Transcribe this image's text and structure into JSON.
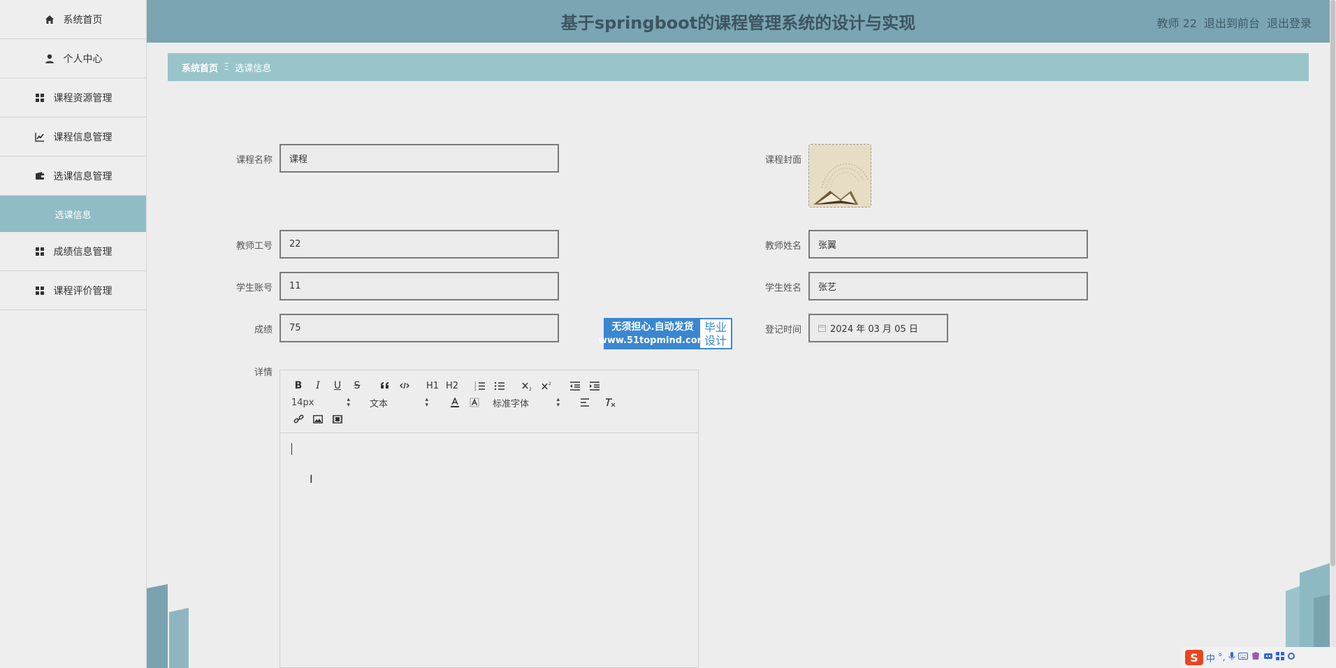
{
  "header": {
    "title": "基于springboot的课程管理系统的设计与实现",
    "user_name": "教师 22",
    "front_label": "退出到前台",
    "logout_label": "退出登录"
  },
  "sidebar": {
    "items": [
      {
        "label": "系统首页",
        "icon": "home-icon"
      },
      {
        "label": "个人中心",
        "icon": "user-icon"
      },
      {
        "label": "课程资源管理",
        "icon": "grid-icon"
      },
      {
        "label": "课程信息管理",
        "icon": "chart-icon"
      },
      {
        "label": "选课信息管理",
        "icon": "wallet-icon"
      },
      {
        "label": "选课信息",
        "icon": ""
      },
      {
        "label": "成绩信息管理",
        "icon": "grid-icon"
      },
      {
        "label": "课程评价管理",
        "icon": "grid-icon"
      }
    ]
  },
  "breadcrumb": {
    "home": "系统首页",
    "separator": "Ξ",
    "current": "选课信息"
  },
  "form": {
    "course_name_label": "课程名称",
    "course_name_value": "课程",
    "course_cover_label": "课程封面",
    "teacher_id_label": "教师工号",
    "teacher_id_value": "22",
    "teacher_name_label": "教师姓名",
    "teacher_name_value": "张翼",
    "student_account_label": "学生账号",
    "student_account_value": "11",
    "student_name_label": "学生姓名",
    "student_name_value": "张艺",
    "score_label": "成绩",
    "score_value": "75",
    "register_time_label": "登记时间",
    "register_time_value": "2024 年 03 月 05 日",
    "detail_label": "详情"
  },
  "ad": {
    "line1": "无须担心.自动发货",
    "line2": "www.51topmind.com",
    "right1": "毕业",
    "right2": "设计"
  },
  "editor": {
    "font_size": "14px",
    "paragraph": "文本",
    "font_family": "标准字体",
    "h1": "H1",
    "h2": "H2",
    "bold": "B",
    "italic": "I",
    "underline": "U",
    "strike": "S"
  },
  "tray": {
    "ime": "中",
    "punct": "°,"
  },
  "colors": {
    "header": "#7ba5b2",
    "breadcrumb": "#99c4ca",
    "active_menu": "#8fbcc5"
  }
}
